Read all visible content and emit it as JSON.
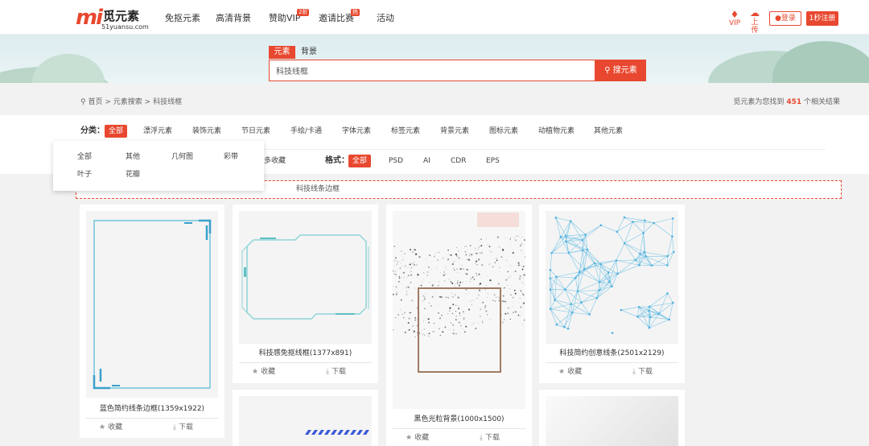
{
  "header": {
    "logo_mark": "mi",
    "logo_name": "觅元素",
    "logo_domain": "51yuansu.com",
    "nav": [
      {
        "label": "免抠元素"
      },
      {
        "label": "高清背景"
      },
      {
        "label": "赞助VIP",
        "badge": "2折"
      },
      {
        "label": "邀请比赛",
        "badge": "热"
      },
      {
        "label": "活动"
      }
    ],
    "vip_label": "VIP",
    "upload_label": "上传",
    "login_label": "登录",
    "register_label": "1秒注册"
  },
  "search": {
    "tabs": [
      "元素",
      "背景"
    ],
    "active_tab": "元素",
    "value": "科技线框",
    "button_label": "搜元素"
  },
  "breadcrumb": {
    "items": [
      "首页",
      "元素搜索",
      "科技线框"
    ],
    "sep": ">"
  },
  "result": {
    "prefix": "觅元素为您找到",
    "count": "451",
    "suffix": "个相关结果"
  },
  "filter": {
    "category_label": "分类：",
    "categories": [
      "全部",
      "漂浮元素",
      "装饰元素",
      "节日元素",
      "手绘/卡通",
      "字体元素",
      "标签元素",
      "背景元素",
      "图标元素",
      "动植物元素",
      "其他元素"
    ],
    "active_category": "全部",
    "sort_partial": "多收藏",
    "format_label": "格式：",
    "formats": [
      "全部",
      "PSD",
      "AI",
      "CDR",
      "EPS"
    ],
    "active_format": "全部",
    "dropdown_items": [
      "全部",
      "其他",
      "几何图",
      "彩带",
      "叶子",
      "花瓣"
    ],
    "related_tags_visible": [
      "科技线条边框"
    ]
  },
  "cards": [
    {
      "title": "蓝色简约线条边框(1359x1922)",
      "collect": "收藏",
      "download": "下载"
    },
    {
      "title": "科技感免抠线框(1377x891)",
      "collect": "收藏",
      "download": "下载"
    },
    {
      "title": "黑色光粒背景(1000x1500)",
      "collect": "收藏",
      "download": "下载"
    },
    {
      "title": "科技简约创意线条(2501x2129)",
      "collect": "收藏",
      "download": "下载"
    }
  ],
  "colors": {
    "brand": "#e8482f",
    "line_blue": "#4fb8d8",
    "frame_teal": "#8fd4d6",
    "frame_brown": "#a07a62"
  },
  "icons": {
    "vip": "diamond-icon",
    "upload": "cloud-upload-icon",
    "login": "user-icon",
    "search": "search-icon",
    "location": "location-pin-icon",
    "collect": "star-icon",
    "download": "download-icon"
  }
}
